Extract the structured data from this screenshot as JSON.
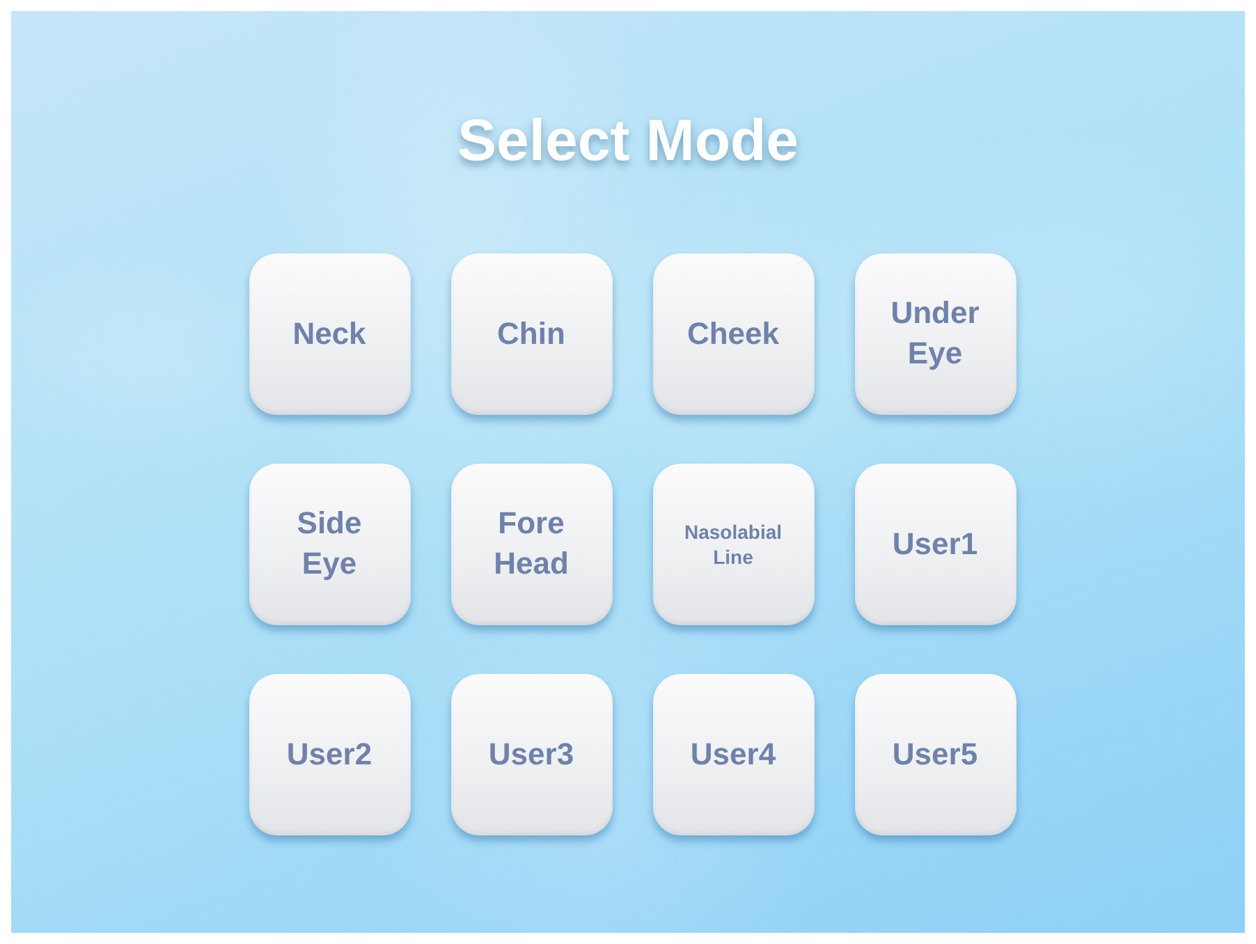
{
  "title": "Select Mode",
  "modes": [
    {
      "label": "Neck"
    },
    {
      "label": "Chin"
    },
    {
      "label": "Cheek"
    },
    {
      "label": "Under\nEye"
    },
    {
      "label": "Side\nEye"
    },
    {
      "label": "Fore\nHead"
    },
    {
      "label": "Nasolabial\nLine"
    },
    {
      "label": "User1"
    },
    {
      "label": "User2"
    },
    {
      "label": "User3"
    },
    {
      "label": "User4"
    },
    {
      "label": "User5"
    }
  ]
}
